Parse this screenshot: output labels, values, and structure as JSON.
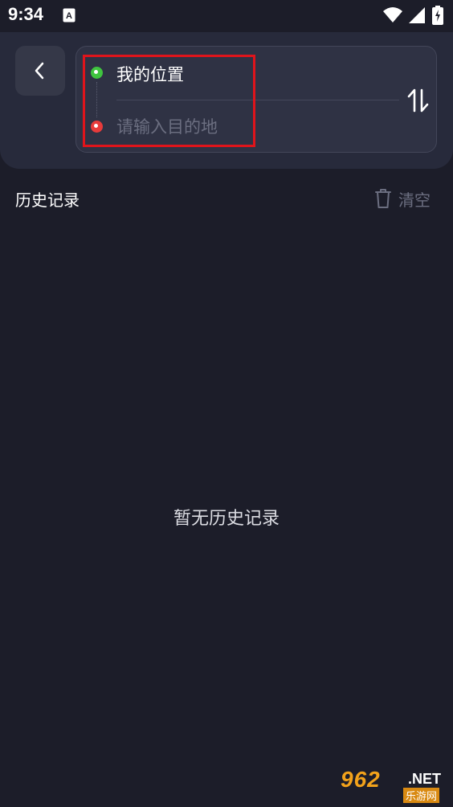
{
  "status_bar": {
    "time": "9:34",
    "app_icon": "a-badge-icon",
    "wifi_icon": "wifi-icon",
    "signal_icon": "signal-icon",
    "battery_icon": "battery-charging-icon"
  },
  "header": {
    "back_icon": "chevron-left-icon",
    "origin_label": "我的位置",
    "destination_placeholder": "请输入目的地",
    "destination_value": "",
    "swap_icon": "swap-vertical-icon",
    "origin_dot_color": "#3fc43f",
    "destination_dot_color": "#e83b3b"
  },
  "history": {
    "title": "历史记录",
    "clear_label": "清空",
    "clear_icon": "trash-icon",
    "empty_message": "暂无历史记录"
  },
  "watermark": {
    "brand": "962",
    "suffix": ".NET",
    "sub": "乐游网"
  },
  "colors": {
    "background": "#1c1d29",
    "header_panel": "#272a3b",
    "card": "#2f3244",
    "muted_text": "#6b6e80",
    "highlight": "#e0141b"
  }
}
